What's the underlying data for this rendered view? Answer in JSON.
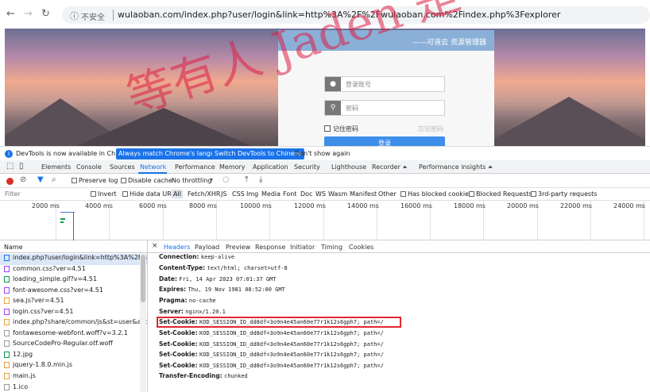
{
  "browser": {
    "insecure": "不安全",
    "url": "wulaoban.com/index.php?user/login&link=http%3A%2F%2Fwulaoban.com%2Findex.php%3Fexplorer"
  },
  "login": {
    "brand": "——可道云 资源管理器",
    "user_placeholder": "登录账号",
    "pass_placeholder": "密码",
    "remember": "记住密码",
    "forgot": "忘记密码",
    "submit": "登录"
  },
  "infobar": {
    "msg": "DevTools is now available in Chinese!",
    "btn1": "Always match Chrome's language",
    "btn2": "Switch DevTools to Chinese",
    "dont": "Don't show again"
  },
  "tabs": [
    "Elements",
    "Console",
    "Sources",
    "Network",
    "Performance",
    "Memory",
    "Application",
    "Security",
    "Lighthouse",
    "Recorder ⏶",
    "Performance insights ⏶"
  ],
  "toolbar": {
    "preserve": "Preserve log",
    "disable": "Disable cache",
    "throttle": "No throttling"
  },
  "filter": {
    "placeholder": "Filter",
    "invert": "Invert",
    "hide": "Hide data URLs",
    "types": [
      "All",
      "Fetch/XHR",
      "JS",
      "CSS",
      "Img",
      "Media",
      "Font",
      "Doc",
      "WS",
      "Wasm",
      "Manifest",
      "Other"
    ],
    "blocked_cookies": "Has blocked cookies",
    "blocked_req": "Blocked Requests",
    "third": "3rd-party requests"
  },
  "timeline": [
    "2000 ms",
    "4000 ms",
    "6000 ms",
    "8000 ms",
    "10000 ms",
    "12000 ms",
    "14000 ms",
    "16000 ms",
    "18000 ms",
    "20000 ms",
    "22000 ms",
    "24000 ms"
  ],
  "requests": {
    "header": "Name",
    "items": [
      "index.php?user/login&link=http%3A%2F%2Fw",
      "common.css?ver=4.51",
      "loading_simple.gif?v=4.51",
      "font-awesome.css?ver=4.51",
      "sea.js?ver=4.51",
      "login.css?ver=4.51",
      "index.php?share/common/js&st=user&act=log",
      "fontawesome-webfont.woff?v=3.2.1",
      "SourceCodePro-Regular.otf.woff",
      "12.jpg",
      "jquery-1.8.0.min.js",
      "main.js",
      "1.ico"
    ]
  },
  "detail": {
    "tabs": [
      "Headers",
      "Payload",
      "Preview",
      "Response",
      "Initiator",
      "Timing",
      "Cookies"
    ],
    "headers": [
      {
        "k": "Connection:",
        "v": "keep-alive"
      },
      {
        "k": "Content-Type:",
        "v": "text/html; charset=utf-8"
      },
      {
        "k": "Date:",
        "v": "Fri, 14 Apr 2023 07:01:37 GMT"
      },
      {
        "k": "Expires:",
        "v": "Thu, 19 Nov 1981 08:52:00 GMT"
      },
      {
        "k": "Pragma:",
        "v": "no-cache"
      },
      {
        "k": "Server:",
        "v": "nginx/1.20.1"
      },
      {
        "k": "Set-Cookie:",
        "v": "KOD_SESSION_ID_dd8df=3o9n4e45an60e77r1k12s6gph7; path=/"
      },
      {
        "k": "Set-Cookie:",
        "v": "KOD_SESSION_ID_dd8df=3o9n4e45an60e77r1k12s6gph7; path=/"
      },
      {
        "k": "Set-Cookie:",
        "v": "KOD_SESSION_ID_dd8df=3o9n4e45an60e77r1k12s6gph7; path=/"
      },
      {
        "k": "Set-Cookie:",
        "v": "KOD_SESSION_ID_dd8df=3o9n4e45an60e77r1k12s6gph7; path=/"
      },
      {
        "k": "Set-Cookie:",
        "v": "KOD_SESSION_ID_dd8df=3o9n4e45an60e77r1k12s6gph7; path=/"
      },
      {
        "k": "Transfer-Encoding:",
        "v": "chunked"
      }
    ]
  },
  "watermark": "等有人 Jaden 是"
}
